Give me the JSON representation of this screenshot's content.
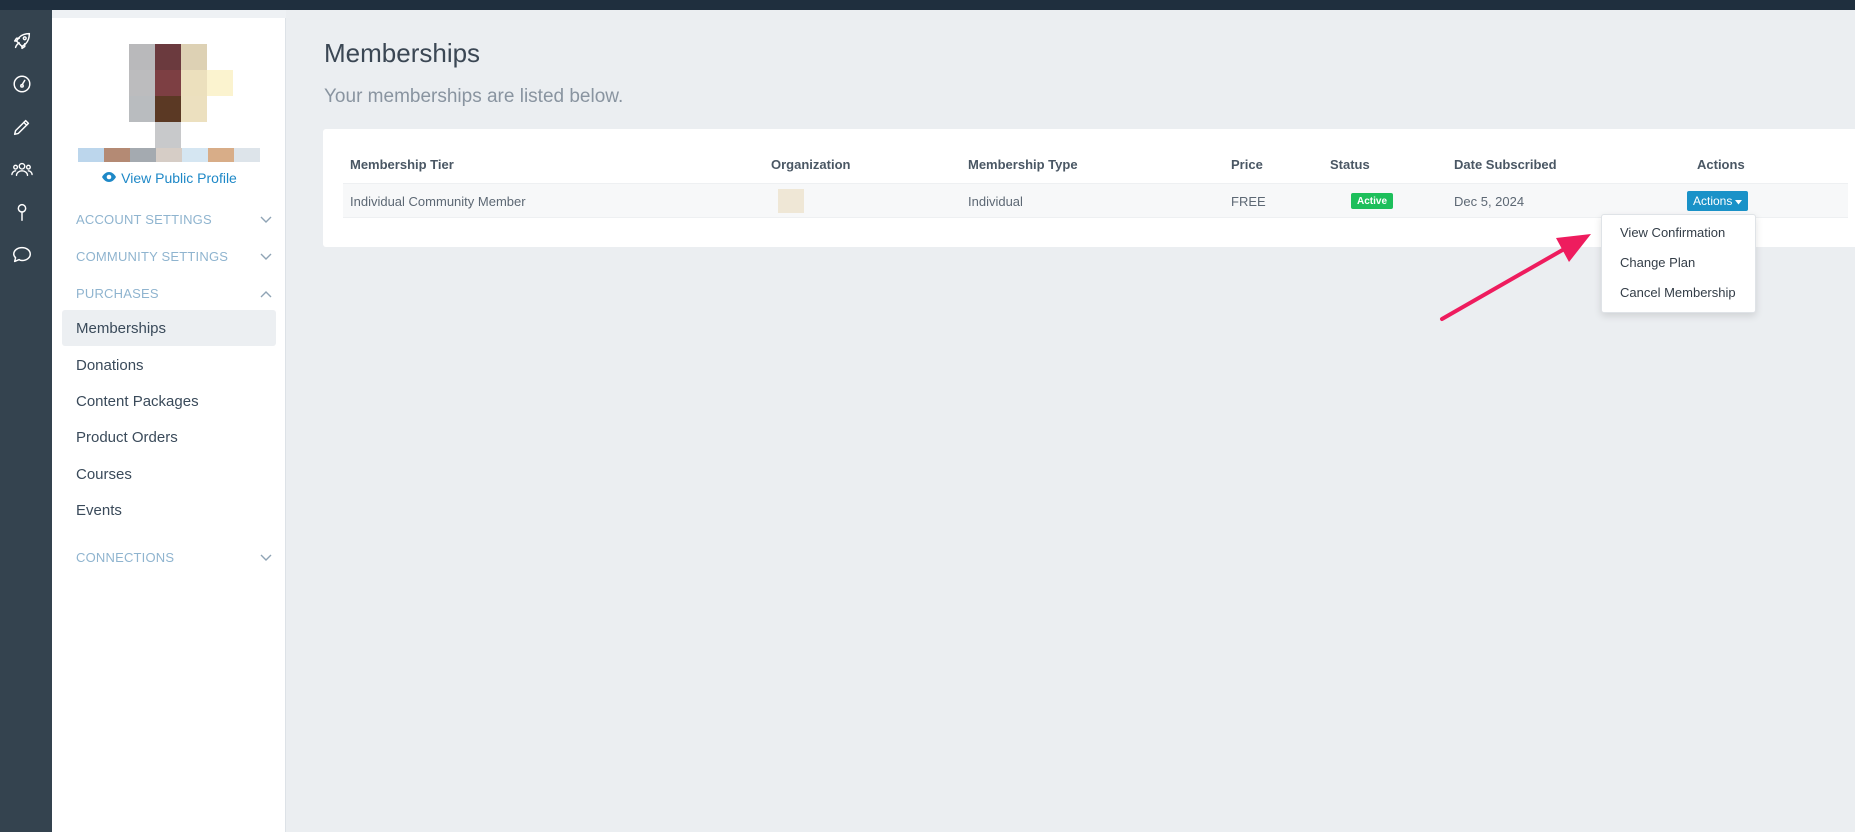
{
  "colors": {
    "topbar": "#1f2f3e",
    "rail": "#34434f",
    "accent": "#1a92c8",
    "link": "#1e88c7",
    "active_badge": "#1dbf5b",
    "annotation_arrow": "#ee1c5e"
  },
  "rail": {
    "icons": [
      "rocket-icon",
      "dashboard-icon",
      "pencil-icon",
      "users-icon",
      "map-pin-icon",
      "chat-icon"
    ]
  },
  "sidebar": {
    "public_profile_link": "View Public Profile",
    "sections": [
      {
        "label": "ACCOUNT SETTINGS",
        "expanded": false
      },
      {
        "label": "COMMUNITY SETTINGS",
        "expanded": false
      },
      {
        "label": "PURCHASES",
        "expanded": true
      },
      {
        "label": "CONNECTIONS",
        "expanded": false
      }
    ],
    "purchases_items": [
      {
        "label": "Memberships",
        "active": true
      },
      {
        "label": "Donations"
      },
      {
        "label": "Content Packages"
      },
      {
        "label": "Product Orders"
      },
      {
        "label": "Courses"
      },
      {
        "label": "Events"
      }
    ]
  },
  "main": {
    "title": "Memberships",
    "subtitle": "Your memberships are listed below.",
    "table": {
      "headers": [
        "Membership Tier",
        "Organization",
        "Membership Type",
        "Price",
        "Status",
        "Date Subscribed",
        "Actions"
      ],
      "rows": [
        {
          "tier": "Individual Community Member",
          "type": "Individual",
          "price": "FREE",
          "status": "Active",
          "date": "Dec 5, 2024",
          "actions_label": "Actions"
        }
      ]
    },
    "actions_menu": [
      "View Confirmation",
      "Change Plan",
      "Cancel Membership"
    ]
  }
}
